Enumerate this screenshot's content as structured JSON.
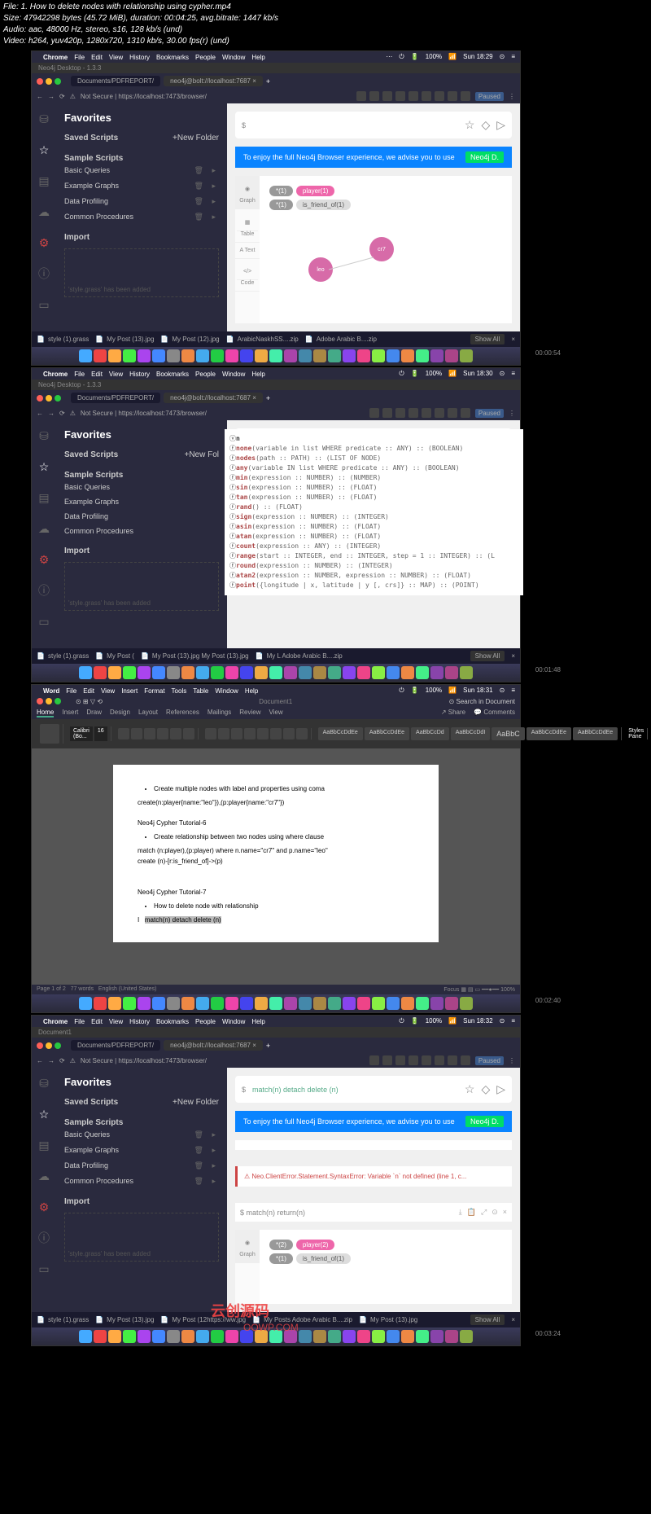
{
  "meta": {
    "l1": "File: 1. How to delete nodes with relationship using cypher.mp4",
    "l2": "Size: 47942298 bytes (45.72 MiB), duration: 00:04:25, avg.bitrate: 1447 kb/s",
    "l3": "Audio: aac, 48000 Hz, stereo, s16, 128 kb/s (und)",
    "l4": "Video: h264, yuv420p, 1280x720, 1310 kb/s, 30.00 fps(r) (und)"
  },
  "mac": {
    "app": "Chrome",
    "menus": [
      "File",
      "Edit",
      "View",
      "History",
      "Bookmarks",
      "People",
      "Window",
      "Help"
    ],
    "wordapp": "Word",
    "wordmenus": [
      "File",
      "Edit",
      "View",
      "Insert",
      "Format",
      "Tools",
      "Table",
      "Window",
      "Help"
    ],
    "right": [
      "100%",
      "Sun 18:29"
    ],
    "right2": [
      "100%",
      "Sun 18:30"
    ],
    "right3": [
      "100%",
      "Sun 18:31"
    ],
    "right4": [
      "100%",
      "Sun 18:32"
    ]
  },
  "chrome": {
    "tab1": "Documents/PDFREPORT/",
    "tab2": "neo4j@bolt://localhost:7687",
    "url": "Not Secure | https://localhost:7473/browser/",
    "paused": "Paused"
  },
  "sidebar": {
    "title": "Favorites",
    "saved": "Saved Scripts",
    "newfolder": "+New Folder",
    "sample": "Sample Scripts",
    "items": [
      "Basic Queries",
      "Example Graphs",
      "Data Profiling",
      "Common Procedures"
    ],
    "import": "Import",
    "dashed": "'style.grass' has been added"
  },
  "query": {
    "prompt": "$",
    "q1": "match(n) detach delete (n)",
    "q2": "$ match(n) return(n)",
    "input": "n"
  },
  "banner": {
    "text": "To enjoy the full Neo4j Browser experience, we advise you to use",
    "btn": "Neo4j D."
  },
  "result": {
    "tabs": [
      "Graph",
      "Table",
      "A Text",
      "Code"
    ],
    "pills": {
      "all": "*(1)",
      "player": "player(1)",
      "friend": "is_friend_of(1)"
    },
    "node1": "leo",
    "node2": "cr7",
    "edge": "is_friend_of"
  },
  "error": "Neo.ClientError.Statement.SyntaxError: Variable `n` not defined (line 1, c...",
  "autocomplete": [
    [
      "none",
      "(variable in list WHERE predicate :: ANY) :: (BOOLEAN)"
    ],
    [
      "nodes",
      "(path :: PATH) :: (LIST OF NODE)"
    ],
    [
      "any",
      "(variable IN list WHERE predicate :: ANY) :: (BOOLEAN)"
    ],
    [
      "min",
      "(expression :: NUMBER) :: (NUMBER)"
    ],
    [
      "sin",
      "(expression :: NUMBER) :: (FLOAT)"
    ],
    [
      "tan",
      "(expression :: NUMBER) :: (FLOAT)"
    ],
    [
      "rand",
      "() :: (FLOAT)"
    ],
    [
      "sign",
      "(expression :: NUMBER) :: (INTEGER)"
    ],
    [
      "asin",
      "(expression :: NUMBER) :: (FLOAT)"
    ],
    [
      "atan",
      "(expression :: NUMBER) :: (FLOAT)"
    ],
    [
      "count",
      "(expression :: ANY) :: (INTEGER)"
    ],
    [
      "range",
      "(start :: INTEGER, end :: INTEGER, step = 1 :: INTEGER) :: (L"
    ],
    [
      "round",
      "(expression :: NUMBER) :: (INTEGER)"
    ],
    [
      "atan2",
      "(expression :: NUMBER, expression :: NUMBER) :: (FLOAT)"
    ],
    [
      "point",
      "({longitude | x, latitude | y [, crs]} :: MAP) :: (POINT)"
    ]
  ],
  "word": {
    "title": "Document1",
    "tabs": [
      "Home",
      "Insert",
      "Draw",
      "Design",
      "Layout",
      "References",
      "Mailings",
      "Review",
      "View"
    ],
    "share": "Share",
    "comments": "Comments",
    "font": "Calibri (Bo...",
    "size": "16",
    "styles": [
      "AaBbCcDdEe",
      "AaBbCcDdEe",
      "AaBbCcDd",
      "AaBbCcDdI",
      "AaBbC",
      "AaBbCcDdEe",
      "AaBbCcDdEe"
    ],
    "pane": "Styles Pane",
    "doc": {
      "b1": "Create multiple nodes with label and properties using coma",
      "c1": "create(n:player{name:\"leo\"}),(p:player{name:\"cr7\"})",
      "t2": "Neo4j Cypher Tutorial-6",
      "b2": "Create relationship between two nodes using where clause",
      "c2a": "match (n:player),(p:player) where n.name=\"cr7\" and p.name=\"leo\"",
      "c2b": "create (n)-[r:is_friend_of]->(p)",
      "t3": "Neo4j Cypher Tutorial-7",
      "b3": "How to delete node with relationship",
      "c3": "match(n) detach delete (n)"
    },
    "status": {
      "page": "Page 1 of 2",
      "words": "77 words",
      "lang": "English (United States)",
      "focus": "Focus",
      "zoom": "100%"
    }
  },
  "taskbar": {
    "files": [
      "style (1).grass",
      "My Post (13).jpg",
      "My Post (12).jpg",
      "ArabicNaskhSS....zip",
      "Adobe Arabic B....zip"
    ],
    "files2": [
      "style (1).grass",
      "My Post (",
      "My Post (13).jpg  My Post (13).jpg",
      "My L  Adobe Arabic B....zip"
    ],
    "files4": [
      "style (1).grass",
      "My Post (13).jpg",
      "My Post (12https://ww.jpg",
      "My Posts Adobe Arabic B....zip",
      "My Post (13).jpg"
    ],
    "showall": "Show All"
  },
  "timestamps": [
    "00:00:54",
    "00:01:48",
    "00:02:40",
    "00:03:24"
  ],
  "watermark": {
    "l1": "云创源码",
    "l2": "OOWP.COM"
  }
}
